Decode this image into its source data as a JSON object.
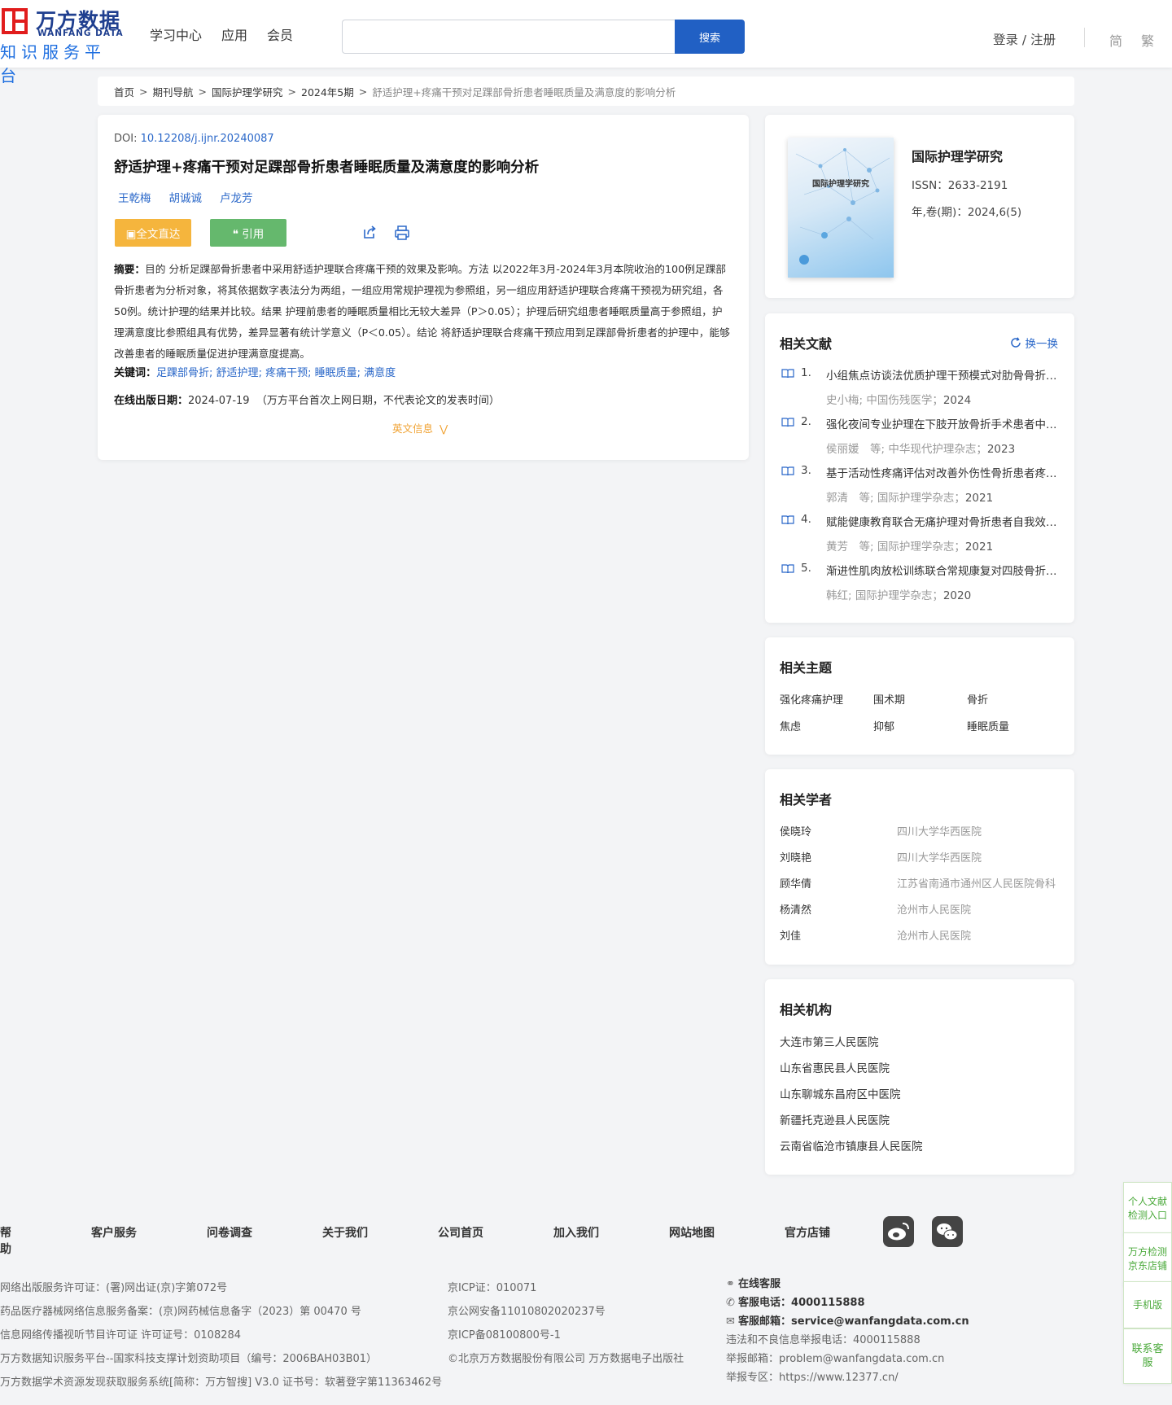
{
  "header": {
    "logo_cn": "万方数据",
    "logo_en": "WANFANG DATA",
    "logo_sub": "知识服务平台",
    "nav": [
      "学习中心",
      "应用",
      "会员"
    ],
    "search_button": "搜索",
    "login": "登录 / 注册",
    "lang_simplified": "简",
    "lang_traditional": "繁"
  },
  "breadcrumb": {
    "items": [
      "首页",
      "期刊导航",
      "国际护理学研究",
      "2024年5期"
    ],
    "current": "舒适护理+疼痛干预对足踝部骨折患者睡眠质量及满意度的影响分析"
  },
  "article": {
    "doi_label": "DOI:",
    "doi": "10.12208/j.ijnr.20240087",
    "title": "舒适护理+疼痛干预对足踝部骨折患者睡眠质量及满意度的影响分析",
    "authors": [
      "王乾梅",
      "胡诚诚",
      "卢龙芳"
    ],
    "btn_fulltext": "全文直达",
    "btn_cite": "引用",
    "abstract_label": "摘要：",
    "abstract": "目的 分析足踝部骨折患者中采用舒适护理联合疼痛干预的效果及影响。方法 以2022年3月-2024年3月本院收治的100例足踝部骨折患者为分析对象，将其依据数字表法分为两组，一组应用常规护理视为参照组，另一组应用舒适护理联合疼痛干预视为研究组，各50例。统计护理的结果并比较。结果 护理前患者的睡眠质量相比无较大差异（P＞0.05）；护理后研究组患者睡眠质量高于参照组，护理满意度比参照组具有优势，差异显著有统计学意义（P＜0.05）。结论 将舒适护理联合疼痛干预应用到足踝部骨折患者的护理中，能够改善患者的睡眠质量促进护理满意度提高。",
    "keywords_label": "关键词：",
    "keywords": [
      "足踝部骨折",
      "舒适护理",
      "疼痛干预",
      "睡眠质量",
      "满意度"
    ],
    "pubdate_label": "在线出版日期：",
    "pubdate": "2024-07-19",
    "pubdate_note": "（万方平台首次上网日期，不代表论文的发表时间）",
    "en_info": "英文信息"
  },
  "journal": {
    "name": "国际护理学研究",
    "cover_title": "国际护理学研究",
    "issn": "ISSN：2633-2191",
    "volume": "年,卷(期)：2024,6(5)"
  },
  "related_literature": {
    "title": "相关文献",
    "refresh": "换一换",
    "items": [
      {
        "num": "1.",
        "title": "小组焦点访谈法优质护理干预模式对肋骨骨折患者的影响",
        "meta": "史小梅; 中国伤残医学；",
        "year": "2024"
      },
      {
        "num": "2.",
        "title": "强化夜间专业护理在下肢开放骨折手术患者中的应用",
        "meta": "侯丽媛　等;  中华现代护理杂志；",
        "year": "2023"
      },
      {
        "num": "3.",
        "title": "基于活动性疼痛评估对改善外伤性骨折患者疼痛的效果",
        "meta": "郭清　等;  国际护理学杂志；",
        "year": "2021"
      },
      {
        "num": "4.",
        "title": "赋能健康教育联合无痛护理对骨折患者自我效能的影响",
        "meta": "黄芳　等;  国际护理学杂志；",
        "year": "2021"
      },
      {
        "num": "5.",
        "title": "渐进性肌肉放松训练联合常规康复对四肢骨折患者的影响",
        "meta": "韩红; 国际护理学杂志；",
        "year": "2020"
      }
    ]
  },
  "related_topics": {
    "title": "相关主题",
    "items": [
      "强化疼痛护理",
      "围术期",
      "骨折",
      "焦虑",
      "抑郁",
      "睡眠质量"
    ]
  },
  "related_scholars": {
    "title": "相关学者",
    "items": [
      {
        "name": "侯晓玲",
        "org": "四川大学华西医院"
      },
      {
        "name": "刘晓艳",
        "org": "四川大学华西医院"
      },
      {
        "name": "顾华倩",
        "org": "江苏省南通市通州区人民医院骨科"
      },
      {
        "name": "杨清然",
        "org": "沧州市人民医院"
      },
      {
        "name": "刘佳",
        "org": "沧州市人民医院"
      }
    ]
  },
  "related_orgs": {
    "title": "相关机构",
    "items": [
      "大连市第三人民医院",
      "山东省惠民县人民医院",
      "山东聊城东昌府区中医院",
      "新疆托克逊县人民医院",
      "云南省临沧市镇康县人民医院"
    ]
  },
  "footer": {
    "nav": [
      "帮助",
      "客户服务",
      "问卷调查",
      "关于我们",
      "公司首页",
      "加入我们",
      "网站地图",
      "官方店铺"
    ],
    "col1": [
      "网络出版服务许可证：(署)网出证(京)字第072号",
      "药品医疗器械网络信息服务备案：(京)网药械信息备字（2023）第 00470 号",
      "信息网络传播视听节目许可证 许可证号：0108284",
      "万方数据知识服务平台--国家科技支撑计划资助项目（编号：2006BAH03B01）",
      "万方数据学术资源发现获取服务系统[简称：万方智搜] V3.0 证书号：软著登字第11363462号"
    ],
    "col2": [
      "京ICP证：010071",
      "京公网安备11010802020237号",
      "京ICP备08100800号-1",
      "©北京万方数据股份有限公司 万方数据电子出版社"
    ],
    "online_service": "在线客服",
    "phone_label": "客服电话：",
    "phone": "4000115888",
    "email_label": "客服邮箱：",
    "email": "service@wanfangdata.com.cn",
    "report_phone": "违法和不良信息举报电话：4000115888",
    "report_email": "举报邮箱：problem@wanfangdata.com.cn",
    "report_site": "举报专区：https://www.12377.cn/"
  },
  "side_widgets": [
    "个人文献检测入口",
    "万方检测京东店铺",
    "手机版",
    "联系客服"
  ],
  "colors": {
    "brand_blue": "#2160c4",
    "link_blue": "#2b68c9",
    "orange": "#f5b53d",
    "green": "#65b86d",
    "logo_red": "#e11d1d"
  }
}
